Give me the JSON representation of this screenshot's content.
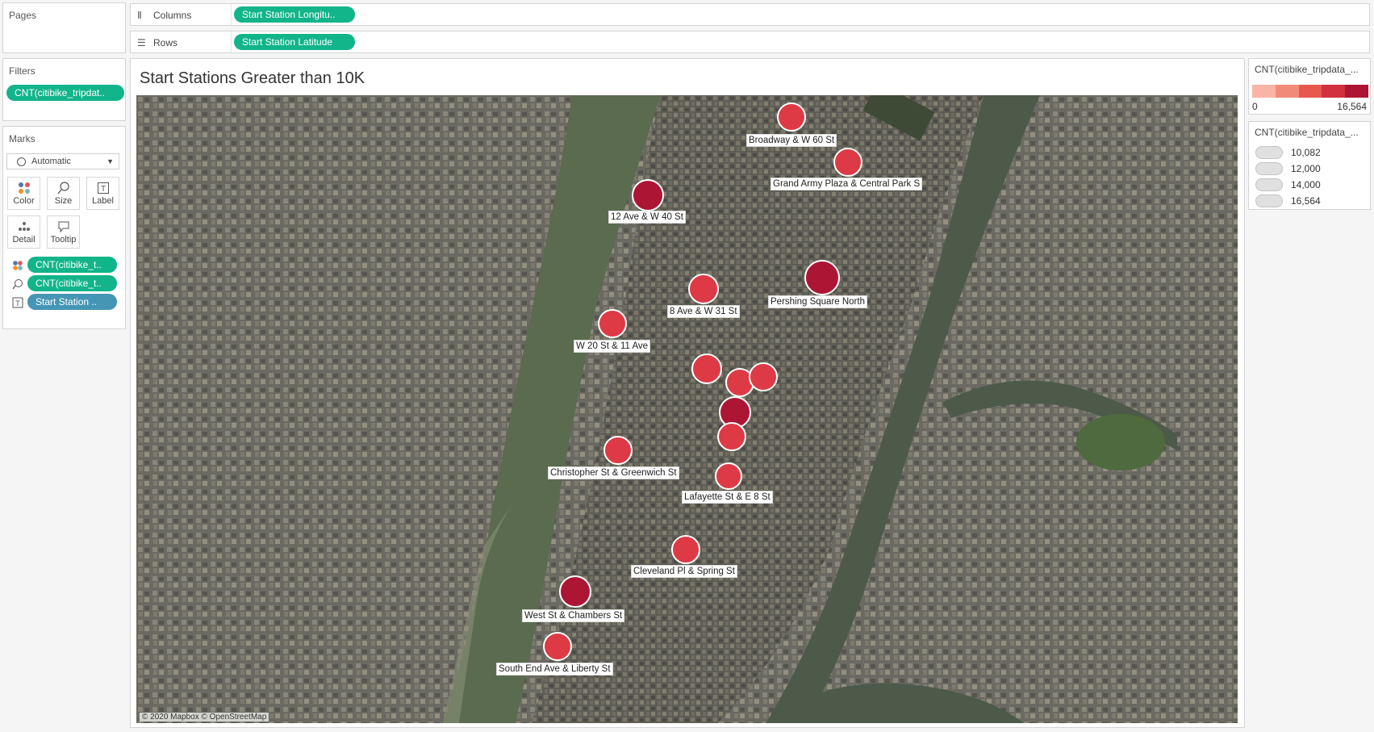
{
  "pages": {
    "title": "Pages"
  },
  "columns": {
    "label": "Columns",
    "pill": "Start Station Longitu.."
  },
  "rows": {
    "label": "Rows",
    "pill": "Start Station Latitude"
  },
  "filters": {
    "title": "Filters",
    "pill": "CNT(citibike_tripdat.."
  },
  "marks": {
    "title": "Marks",
    "type": "Automatic",
    "buttons": [
      "Color",
      "Size",
      "Label",
      "Detail",
      "Tooltip"
    ],
    "pills": [
      {
        "icon": "color-dots-icon",
        "label": "CNT(citibike_t..",
        "color": "#12b48a"
      },
      {
        "icon": "size-icon",
        "label": "CNT(citibike_t..",
        "color": "#12b48a"
      },
      {
        "icon": "label-icon",
        "label": "Start Station ..",
        "color": "#4596b5"
      }
    ]
  },
  "chart": {
    "title": "Start Stations Greater than 10K",
    "credit": "© 2020 Mapbox © OpenStreetMap"
  },
  "color_legend": {
    "title": "CNT(citibike_tripdata_...",
    "min": "0",
    "max": "16,564",
    "swatches": [
      "#f9b4a8",
      "#f28a7a",
      "#e8584f",
      "#d1303e",
      "#ad1535"
    ]
  },
  "size_legend": {
    "title": "CNT(citibike_tripdata_...",
    "values": [
      "10,082",
      "12,000",
      "14,000",
      "16,564"
    ]
  },
  "stations": [
    {
      "label": "Broadway & W 60 St"
    },
    {
      "label": "Grand Army Plaza & Central Park S"
    },
    {
      "label": "12 Ave & W 40 St"
    },
    {
      "label": "Pershing Square North"
    },
    {
      "label": "8 Ave & W 31 St"
    },
    {
      "label": "W 20 St & 11 Ave"
    },
    {
      "label": "Christopher St & Greenwich St"
    },
    {
      "label": "Lafayette St & E 8 St"
    },
    {
      "label": "Cleveland Pl & Spring St"
    },
    {
      "label": "West St & Chambers St"
    },
    {
      "label": "South End Ave & Liberty St"
    }
  ]
}
